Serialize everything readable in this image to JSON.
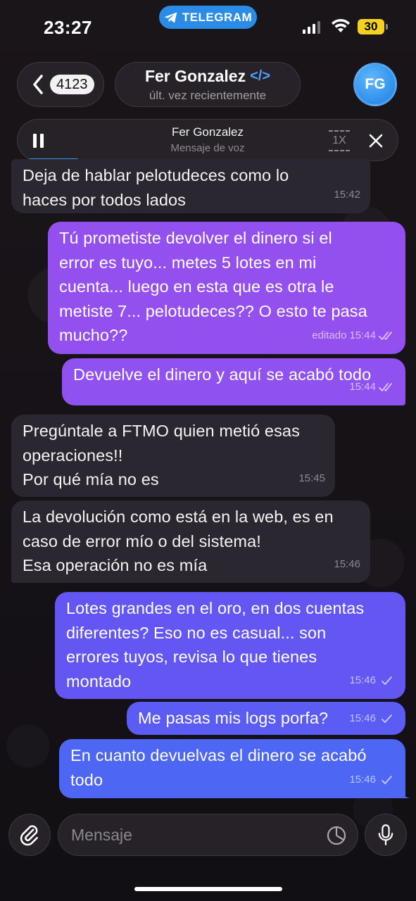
{
  "status_bar": {
    "time": "23:27",
    "app_pill": "TELEGRAM",
    "battery": "30"
  },
  "header": {
    "back_count": "4123",
    "contact_name": "Fer Gonzalez",
    "contact_status": "últ. vez recientemente",
    "avatar_initials": "FG",
    "code_icon": "</>"
  },
  "voice_player": {
    "title": "Fer Gonzalez",
    "subtitle": "Mensaje de voz",
    "speed": "1X"
  },
  "messages": [
    {
      "direction": "in",
      "text": "Deja de hablar pelotudeces como lo\nhaces por todos lados",
      "time": "15:42"
    },
    {
      "direction": "out",
      "text": "Tú prometiste devolver el dinero si el\nerror es tuyo... metes 5 lotes en mi\ncuenta... luego en esta que es otra le\nmetiste 7... pelotudeces?? O esto te pasa\nmucho??",
      "edited": "editado",
      "time": "15:44"
    },
    {
      "direction": "out",
      "text": "Devuelve el dinero y aquí se acabó todo",
      "time": "15:44"
    },
    {
      "direction": "in",
      "text": "Pregúntale a FTMO quien metió esas\noperaciones!!\nPor qué mía no es",
      "time": "15:45"
    },
    {
      "direction": "in",
      "text": "La devolución como está en la web, es en\ncaso de error mío o del sistema!\nEsa operación no es mía",
      "time": "15:46"
    },
    {
      "direction": "out",
      "text": "Lotes grandes en el oro, en dos cuentas\ndiferentes? Eso no es casual... son\nerrores tuyos, revisa lo que tienes\nmontado",
      "time": "15:46"
    },
    {
      "direction": "out",
      "text": "Me pasas mis logs porfa?",
      "time": "15:46"
    },
    {
      "direction": "out",
      "text": "En cuanto devuelvas el dinero se acabó\ntodo",
      "time": "15:46"
    }
  ],
  "composer": {
    "placeholder": "Mensaje"
  },
  "colors": {
    "incoming_bubble": "#2b2730",
    "outgoing_top": "#9a4ff0",
    "outgoing_bottom": "#4a6cf3",
    "accent": "#2a8ce6"
  }
}
